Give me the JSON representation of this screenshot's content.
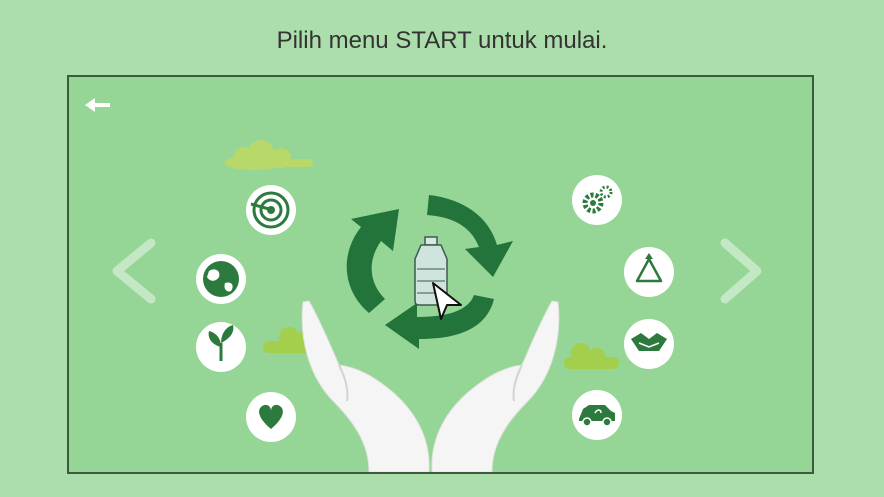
{
  "instruction": "Pilih menu START untuk mulai.",
  "icons": {
    "back": "back-arrow-icon",
    "prev": "chevron-left-icon",
    "next": "chevron-right-icon",
    "center": "recycle-bottle-icon",
    "left": [
      "target-icon",
      "globe-icon",
      "plant-icon",
      "heart-icon"
    ],
    "right": [
      "gears-icon",
      "recycle-icon",
      "handshake-icon",
      "eco-car-icon"
    ]
  },
  "colors": {
    "background": "#abdeaa",
    "stage": "#95d595",
    "frame_border": "#3c5a3c",
    "accent_dark": "#2d7a3e",
    "cloud": "#b8d96a"
  }
}
